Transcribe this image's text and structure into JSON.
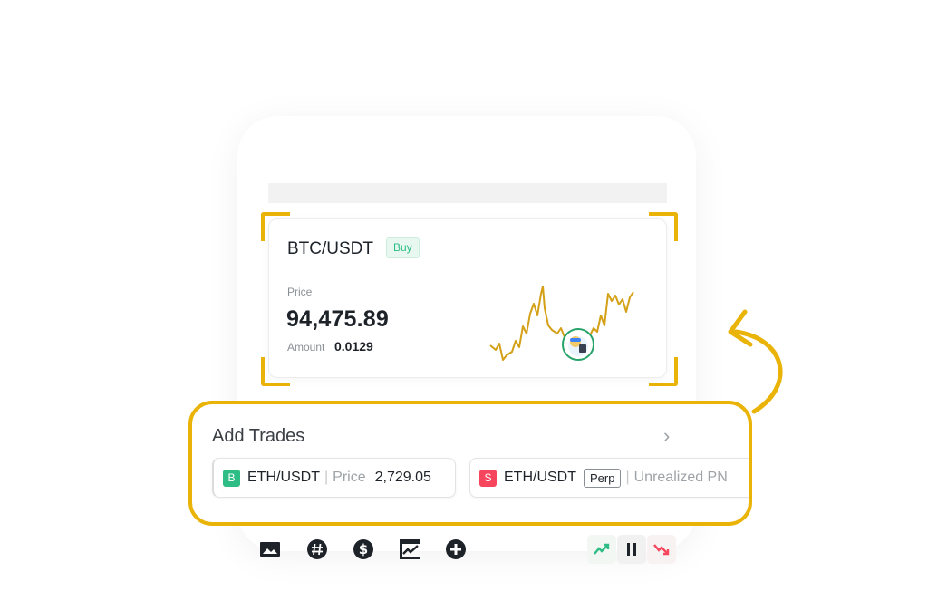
{
  "trade_card": {
    "pair": "BTC/USDT",
    "side_badge": "Buy",
    "price_label": "Price",
    "price": "94,475.89",
    "amount_label": "Amount",
    "amount": "0.0129"
  },
  "add_trades": {
    "title": "Add Trades",
    "items": [
      {
        "side": "B",
        "pair": "ETH/USDT",
        "field_label": "Price",
        "field_value": "2,729.05"
      },
      {
        "side": "S",
        "pair": "ETH/USDT",
        "type_badge": "Perp",
        "field_label": "Unrealized PN"
      }
    ]
  },
  "toolbar": {
    "icons": [
      "image-icon",
      "hashtag-icon",
      "dollar-icon",
      "chart-icon",
      "add-icon"
    ],
    "trend": [
      "trend-up-icon",
      "pause-icon",
      "trend-down-icon"
    ]
  },
  "colors": {
    "accent_yellow": "#eab308",
    "buy_green": "#2ebd85",
    "sell_red": "#f6465d",
    "sparkline": "#d4a017"
  }
}
